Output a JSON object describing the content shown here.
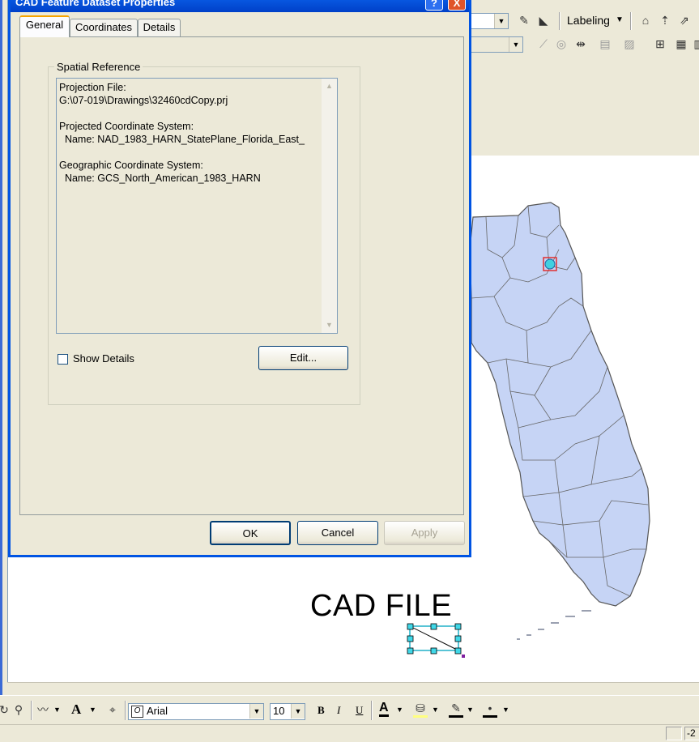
{
  "dialog": {
    "title": "CAD Feature Dataset Properties",
    "tabs": [
      {
        "label": "General"
      },
      {
        "label": "Coordinates"
      },
      {
        "label": "Details"
      }
    ],
    "spatial_reference": {
      "group_label": "Spatial Reference",
      "text": "Projection File:\nG:\\07-019\\Drawings\\32460cdCopy.prj\n\nProjected Coordinate System:\n  Name: NAD_1983_HARN_StatePlane_Florida_East_\n\nGeographic Coordinate System:\n  Name: GCS_North_American_1983_HARN"
    },
    "show_details_label": "Show Details",
    "show_details_checked": false,
    "edit_button": "Edit...",
    "ok_button": "OK",
    "cancel_button": "Cancel",
    "apply_button": "Apply",
    "title_button_help": "?",
    "title_button_close": "X"
  },
  "toolbar": {
    "labeling_label": "Labeling",
    "font_name": "Arial",
    "font_size": "10",
    "bold": "B",
    "italic": "I",
    "underline": "U",
    "font_color": "A"
  },
  "map": {
    "cad_label": "CAD FILE",
    "state_fill": "#c6d4f5",
    "state_stroke": "#555555"
  },
  "status": {
    "coord": "-2"
  }
}
